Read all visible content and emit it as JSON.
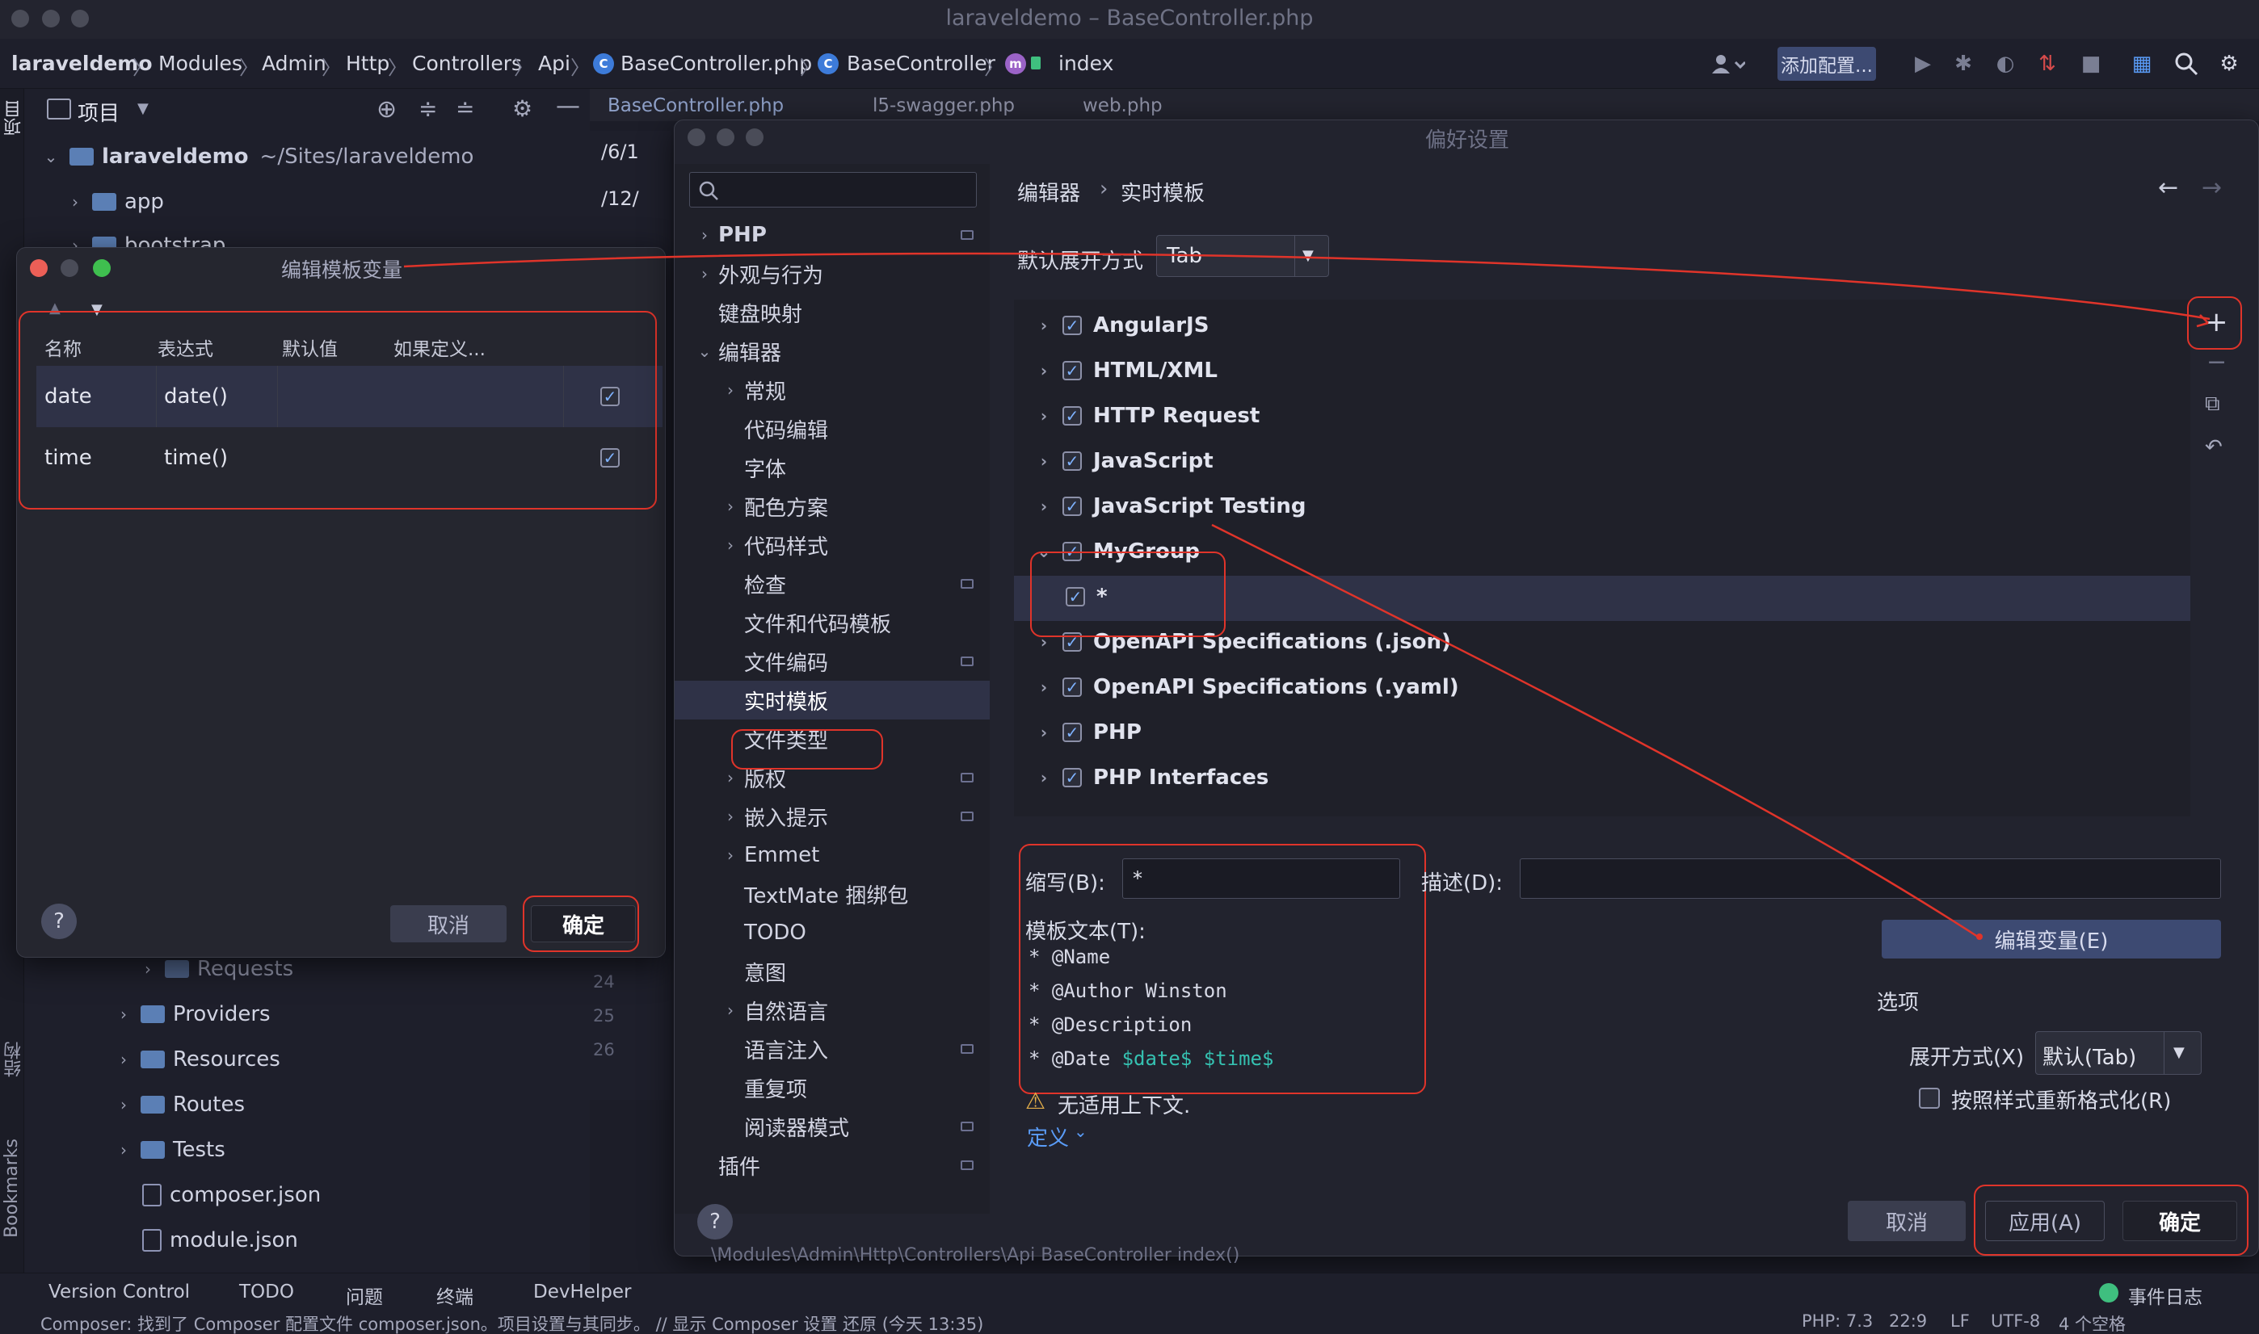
{
  "window": {
    "title": "laraveldemo – BaseController.php"
  },
  "breadcrumb": {
    "items": [
      "laraveldemo",
      "Modules",
      "Admin",
      "Http",
      "Controllers",
      "Api",
      "BaseController.php",
      "BaseController",
      "index"
    ],
    "add_config": "添加配置..."
  },
  "left_strip": {
    "project": "项目",
    "structure": "结构",
    "bookmarks": "Bookmarks"
  },
  "project": {
    "toolbar_label": "项目",
    "root_name": "laraveldemo",
    "root_path": "~/Sites/laraveldemo",
    "items": [
      "app",
      "bootstrap",
      "Requests",
      "Providers",
      "Resources",
      "Routes",
      "Tests",
      "composer.json",
      "module.json"
    ]
  },
  "editor": {
    "tabs": [
      "BaseController.php",
      "l5-swagger.php",
      "web.php"
    ],
    "search_hits": [
      "/6/1",
      "/12/"
    ],
    "gutter": [
      "24",
      "25",
      "26"
    ],
    "footer_crumb": "\\Modules\\Admin\\Http\\Controllers\\Api   BaseController   index()"
  },
  "vars_dialog": {
    "title": "编辑模板变量",
    "columns": [
      "名称",
      "表达式",
      "默认值",
      "如果定义..."
    ],
    "rows": [
      {
        "name": "date",
        "expr": "date()",
        "default": "",
        "skip": true
      },
      {
        "name": "time",
        "expr": "time()",
        "default": "",
        "skip": true
      }
    ],
    "cancel": "取消",
    "ok": "确定",
    "help": "?"
  },
  "prefs": {
    "title": "偏好设置",
    "search_placeholder": "",
    "sidebar": [
      {
        "label": "PHP",
        "level": 0,
        "expand": "right",
        "mini": true
      },
      {
        "label": "外观与行为",
        "level": 0,
        "expand": "right",
        "mini": false
      },
      {
        "label": "键盘映射",
        "level": 0,
        "expand": "none",
        "mini": false
      },
      {
        "label": "编辑器",
        "level": 0,
        "expand": "down",
        "mini": false
      },
      {
        "label": "常规",
        "level": 1,
        "expand": "right",
        "mini": false
      },
      {
        "label": "代码编辑",
        "level": 1,
        "expand": "none",
        "mini": false
      },
      {
        "label": "字体",
        "level": 1,
        "expand": "none",
        "mini": false
      },
      {
        "label": "配色方案",
        "level": 1,
        "expand": "right",
        "mini": false
      },
      {
        "label": "代码样式",
        "level": 1,
        "expand": "right",
        "mini": false
      },
      {
        "label": "检查",
        "level": 1,
        "expand": "none",
        "mini": true
      },
      {
        "label": "文件和代码模板",
        "level": 1,
        "expand": "none",
        "mini": false
      },
      {
        "label": "文件编码",
        "level": 1,
        "expand": "none",
        "mini": true
      },
      {
        "label": "实时模板",
        "level": 1,
        "expand": "none",
        "mini": false
      },
      {
        "label": "文件类型",
        "level": 1,
        "expand": "none",
        "mini": false
      },
      {
        "label": "版权",
        "level": 1,
        "expand": "right",
        "mini": true
      },
      {
        "label": "嵌入提示",
        "level": 1,
        "expand": "right",
        "mini": true
      },
      {
        "label": "Emmet",
        "level": 1,
        "expand": "right",
        "mini": false
      },
      {
        "label": "TextMate 捆绑包",
        "level": 1,
        "expand": "none",
        "mini": false
      },
      {
        "label": "TODO",
        "level": 1,
        "expand": "none",
        "mini": false
      },
      {
        "label": "意图",
        "level": 1,
        "expand": "none",
        "mini": false
      },
      {
        "label": "自然语言",
        "level": 1,
        "expand": "right",
        "mini": false
      },
      {
        "label": "语言注入",
        "level": 1,
        "expand": "none",
        "mini": true
      },
      {
        "label": "重复项",
        "level": 1,
        "expand": "none",
        "mini": false
      },
      {
        "label": "阅读器模式",
        "level": 1,
        "expand": "none",
        "mini": true
      },
      {
        "label": "插件",
        "level": 0,
        "expand": "none",
        "mini": true
      }
    ],
    "crumb": [
      "编辑器",
      "实时模板"
    ],
    "expand_with_label": "默认展开方式",
    "expand_with_value": "Tab",
    "template_groups": [
      {
        "name": "AngularJS",
        "expanded": false
      },
      {
        "name": "HTML/XML",
        "expanded": false
      },
      {
        "name": "HTTP Request",
        "expanded": false
      },
      {
        "name": "JavaScript",
        "expanded": false
      },
      {
        "name": "JavaScript Testing",
        "expanded": false
      },
      {
        "name": "MyGroup",
        "expanded": true
      },
      {
        "name": "*",
        "child": true
      },
      {
        "name": "OpenAPI Specifications (.json)",
        "expanded": false
      },
      {
        "name": "OpenAPI Specifications (.yaml)",
        "expanded": false
      },
      {
        "name": "PHP",
        "expanded": false
      },
      {
        "name": "PHP Interfaces",
        "expanded": false
      }
    ],
    "abbrev_label": "缩写(B):",
    "abbrev_value": "*",
    "desc_label": "描述(D):",
    "desc_value": "",
    "template_text_label": "模板文本(T):",
    "template_lines": [
      {
        "text": "* @Name",
        "vars": ""
      },
      {
        "text": "* @Author Winston",
        "vars": ""
      },
      {
        "text": "* @Description",
        "vars": ""
      },
      {
        "text": "* @Date ",
        "vars": "$date$ $time$"
      }
    ],
    "edit_vars_button": "编辑变量(E)",
    "options_label": "选项",
    "expand_mode_label": "展开方式(X)",
    "expand_mode_value": "默认(Tab)",
    "reformat_label": "按照样式重新格式化(R)",
    "warning": "无适用上下文.",
    "define": "定义",
    "cancel": "取消",
    "apply": "应用(A)",
    "ok": "确定",
    "help": "?"
  },
  "toolwindows": [
    "Version Control",
    "TODO",
    "问题",
    "终端",
    "DevHelper"
  ],
  "event_log": "事件日志",
  "status": {
    "message": "Composer: 找到了 Composer 配置文件 composer.json。项目设置与其同步。 // 显示 Composer 设置   还原 (今天 13:35)",
    "php": "PHP: 7.3",
    "pos": "22:9",
    "lf": "LF",
    "enc": "UTF-8",
    "indent": "4 个空格"
  },
  "colors": {
    "accent_red": "#e0342a",
    "var_teal": "#35c1b1",
    "link_blue": "#5a9cf8",
    "selection": "#2f3247"
  }
}
